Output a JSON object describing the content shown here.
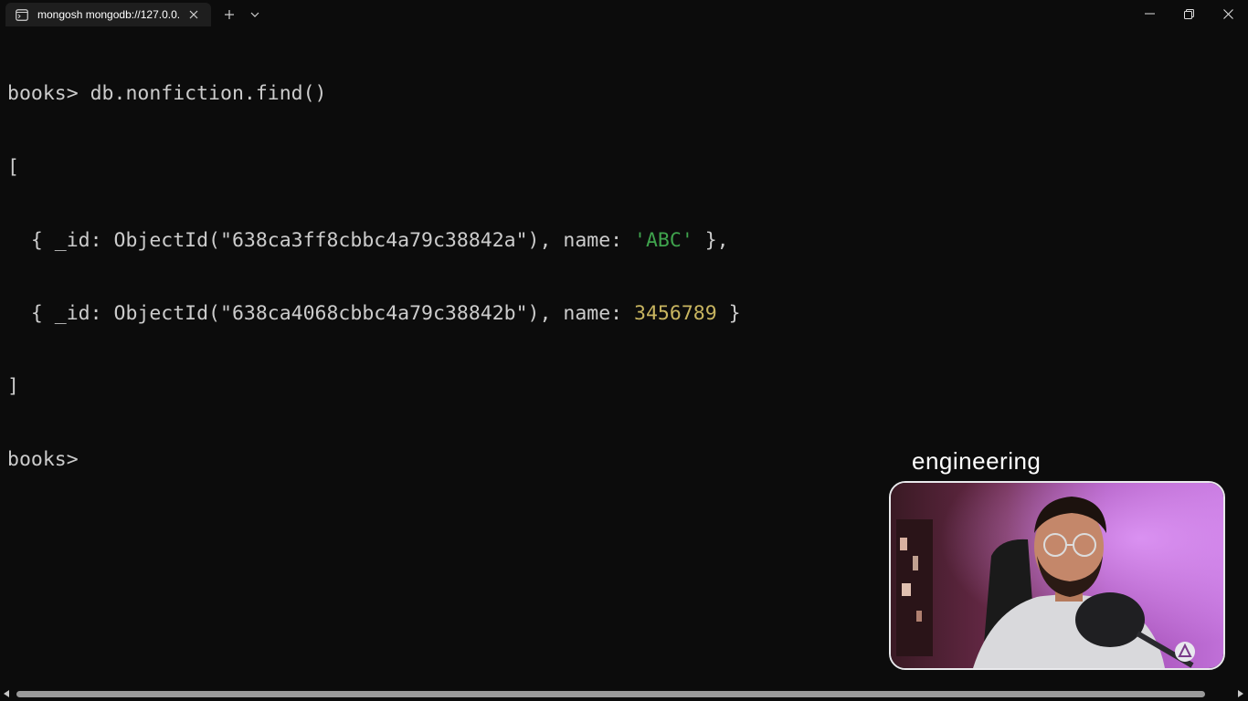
{
  "tab": {
    "title": "mongosh mongodb://127.0.0.",
    "icon": "terminal-icon"
  },
  "window_controls": {
    "new_tab": "plus-icon",
    "dropdown": "chevron-down-icon",
    "minimize": "minimize-icon",
    "maximize": "restore-icon",
    "close": "close-icon"
  },
  "terminal": {
    "command_prompt": "books> ",
    "command": "db.nonfiction.find()",
    "open_bracket": "[",
    "results": [
      {
        "prefix": "  { _id: ObjectId(\"638ca3ff8cbbc4a79c38842a\"), name: ",
        "value": "'ABC'",
        "value_type": "string",
        "suffix": " },"
      },
      {
        "prefix": "  { _id: ObjectId(\"638ca4068cbbc4a79c38842b\"), name: ",
        "value": "3456789",
        "value_type": "number",
        "suffix": " }"
      }
    ],
    "close_bracket": "]",
    "final_prompt": "books> "
  },
  "webcam": {
    "label": "engineering"
  },
  "colors": {
    "background": "#0c0c0c",
    "text": "#cccccc",
    "string": "#3fa34d",
    "number": "#c8b560"
  }
}
